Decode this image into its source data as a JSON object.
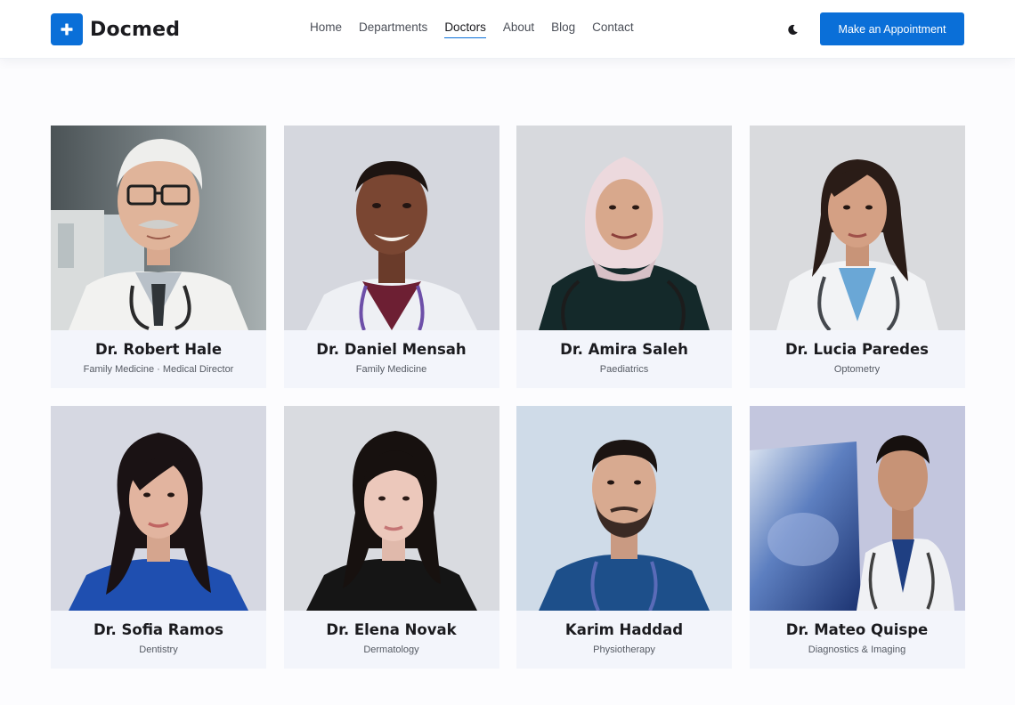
{
  "header": {
    "logo_text": "Docmed",
    "logo_icon": "plus-icon",
    "theme_icon": "moon-icon",
    "cta_label": "Make an Appointment",
    "nav": [
      {
        "label": "Home",
        "active": false
      },
      {
        "label": "Departments",
        "active": false
      },
      {
        "label": "Doctors",
        "active": true
      },
      {
        "label": "About",
        "active": false
      },
      {
        "label": "Blog",
        "active": false
      },
      {
        "label": "Contact",
        "active": false
      }
    ]
  },
  "doctors": [
    {
      "name": "Dr. Robert Hale",
      "specialty": "Family Medicine · Medical Director"
    },
    {
      "name": "Dr. Daniel Mensah",
      "specialty": "Family Medicine"
    },
    {
      "name": "Dr. Amira Saleh",
      "specialty": "Paediatrics"
    },
    {
      "name": "Dr. Lucia Paredes",
      "specialty": "Optometry"
    },
    {
      "name": "Dr. Sofia Ramos",
      "specialty": "Dentistry"
    },
    {
      "name": "Dr. Elena Novak",
      "specialty": "Dermatology"
    },
    {
      "name": "Karim Haddad",
      "specialty": "Physiotherapy"
    },
    {
      "name": "Dr. Mateo Quispe",
      "specialty": "Diagnostics & Imaging"
    }
  ],
  "colors": {
    "accent": "#0a6fd8",
    "card_background": "#f3f5fb",
    "page_background": "#fcfcfe"
  }
}
